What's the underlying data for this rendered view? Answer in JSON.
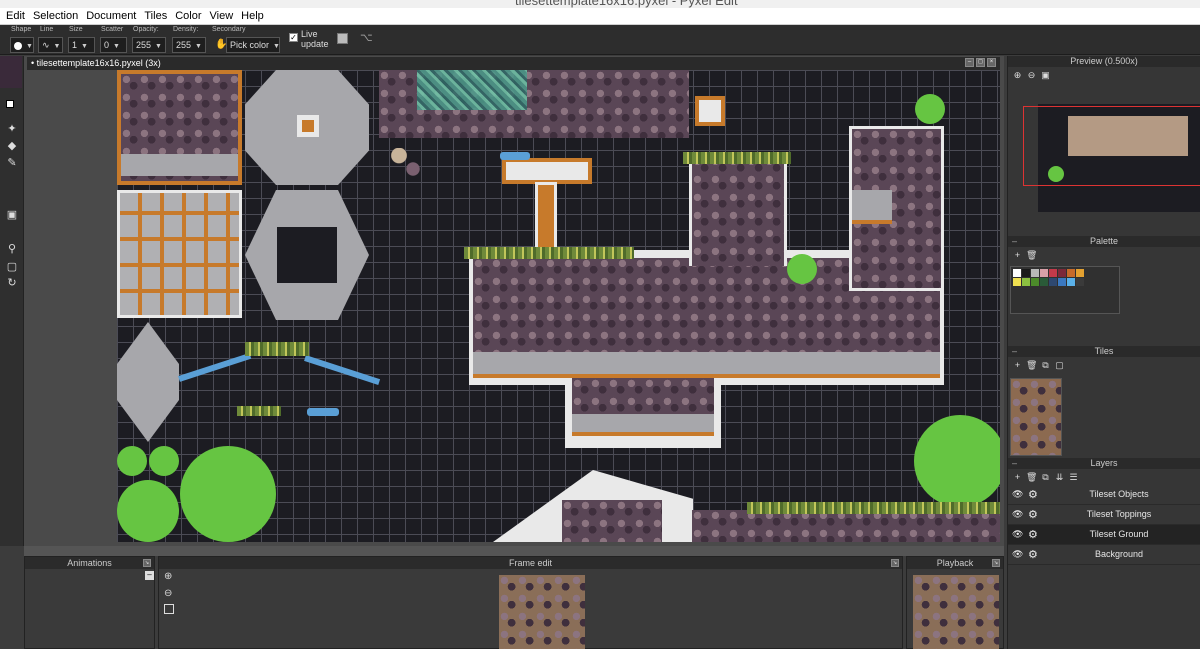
{
  "window": {
    "title": "tilesettemplate16x16.pyxel - Pyxel Edit"
  },
  "menu": [
    "Edit",
    "Selection",
    "Document",
    "Tiles",
    "Color",
    "View",
    "Help"
  ],
  "toolbar": {
    "shape_label": "Shape",
    "line_label": "Line",
    "size_label": "Size",
    "size_value": "1",
    "scatter_label": "Scatter",
    "scatter_value": "0",
    "opacity_label": "Opacity:",
    "opacity_value": "255",
    "density_label": "Density:",
    "density_value": "255",
    "secondary_label": "Secondary",
    "pick_color_label": "Pick color",
    "live_update_label": "Live update"
  },
  "document": {
    "tab_label": "• tilesettemplate16x16.pyxel  (3x)"
  },
  "panels": {
    "preview_title": "Preview (0.500x)",
    "palette_title": "Palette",
    "tiles_title": "Tiles",
    "layers_title": "Layers",
    "animations_title": "Animations",
    "frame_edit_title": "Frame edit",
    "playback_title": "Playback"
  },
  "layers": [
    {
      "name": "Tileset Objects",
      "active": false
    },
    {
      "name": "Tileset Toppings",
      "active": false
    },
    {
      "name": "Tileset Ground",
      "active": true
    },
    {
      "name": "Background",
      "active": false
    }
  ],
  "palette_colors": [
    "#ffffff",
    "#1a1a1a",
    "#b8b8b8",
    "#d9a0a8",
    "#c23a4a",
    "#7b2838",
    "#c56a2a",
    "#e2a030",
    "#efe050",
    "#8cc040",
    "#4c8a2a",
    "#2a5a38",
    "#2e4870",
    "#3a78c0",
    "#5ab0e8",
    "#3a3a3a"
  ],
  "colors": {
    "accent_orange": "#c77a2b",
    "canvas_dark": "#1c1c22",
    "green": "#66c542",
    "blue": "#5a9fd6"
  }
}
